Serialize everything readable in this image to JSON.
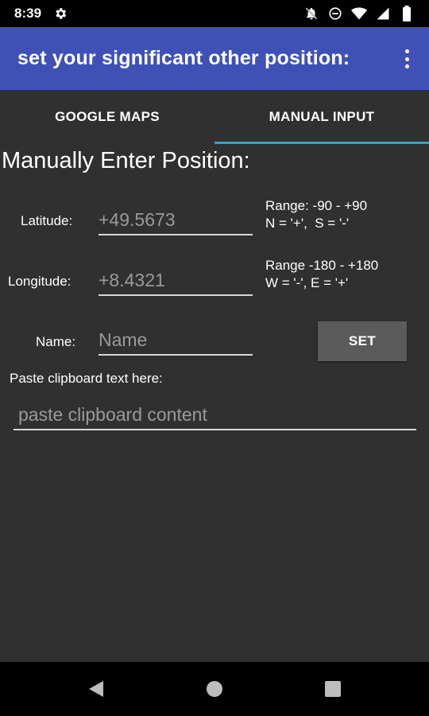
{
  "status_bar": {
    "time": "8:39",
    "icons": [
      "gear-icon",
      "mute-icon",
      "do-not-disturb-icon",
      "wifi-icon",
      "signal-icon",
      "battery-icon"
    ]
  },
  "app_bar": {
    "title": "set your significant other position:",
    "overflow_icon": "more-vert-icon"
  },
  "tabs": [
    {
      "label": "GOOGLE MAPS",
      "active": false
    },
    {
      "label": "MANUAL INPUT",
      "active": true
    }
  ],
  "form": {
    "heading": "Manually Enter Position:",
    "latitude": {
      "label": "Latitude:",
      "placeholder": "+49.5673",
      "value": "",
      "hint_line1": "Range: -90 - +90",
      "hint_line2": "N = '+',  S = '-'"
    },
    "longitude": {
      "label": "Longitude:",
      "placeholder": "+8.4321",
      "value": "",
      "hint_line1": "Range -180 - +180",
      "hint_line2": "W = '-', E = '+'"
    },
    "name": {
      "label": "Name:",
      "placeholder": "Name",
      "value": ""
    },
    "set_button": "SET",
    "paste": {
      "label": "Paste clipboard text here:",
      "placeholder": "paste clipboard content",
      "value": ""
    }
  },
  "colors": {
    "app_bar": "#3f51b5",
    "background": "#303030",
    "tab_indicator": "#26a6d9",
    "button": "#5b5b5b"
  },
  "nav_bar": {
    "icons": [
      "back-icon",
      "home-icon",
      "recents-icon"
    ]
  }
}
